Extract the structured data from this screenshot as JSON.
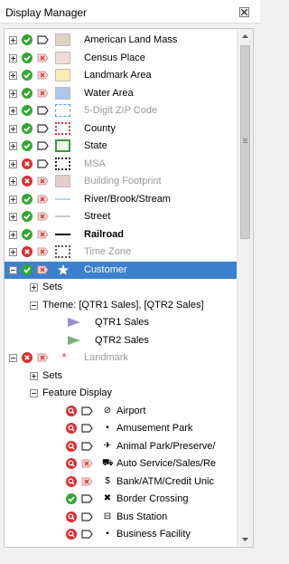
{
  "window": {
    "title": "Display Manager"
  },
  "layers": [
    {
      "label": "American Land Mass",
      "status": "on",
      "tagged": false,
      "symbol": "fill-tan",
      "gray": false,
      "bold": false
    },
    {
      "label": "Census Place",
      "status": "on",
      "tagged": true,
      "symbol": "fill-pink",
      "gray": false,
      "bold": false
    },
    {
      "label": "Landmark Area",
      "status": "on",
      "tagged": true,
      "symbol": "fill-yellow",
      "gray": false,
      "bold": false
    },
    {
      "label": "Water Area",
      "status": "on",
      "tagged": true,
      "symbol": "fill-blue",
      "gray": false,
      "bold": false
    },
    {
      "label": "5-Digit ZIP Code",
      "status": "on",
      "tagged": false,
      "symbol": "dashed-blue",
      "gray": true,
      "bold": false
    },
    {
      "label": "County",
      "status": "on",
      "tagged": false,
      "symbol": "dotted-red",
      "gray": false,
      "bold": false
    },
    {
      "label": "State",
      "status": "on",
      "tagged": false,
      "symbol": "solid-green",
      "gray": false,
      "bold": false
    },
    {
      "label": "MSA",
      "status": "off",
      "tagged": false,
      "symbol": "dotted-black",
      "gray": true,
      "bold": false
    },
    {
      "label": "Building Footprint",
      "status": "off",
      "tagged": true,
      "symbol": "fill-pink-gray",
      "gray": true,
      "bold": false
    },
    {
      "label": "River/Brook/Stream",
      "status": "on",
      "tagged": true,
      "symbol": "line-blue",
      "gray": false,
      "bold": false
    },
    {
      "label": "Street",
      "status": "on",
      "tagged": true,
      "symbol": "line-gray",
      "gray": false,
      "bold": false
    },
    {
      "label": "Railroad",
      "status": "on",
      "tagged": true,
      "symbol": "line-black",
      "gray": false,
      "bold": true
    },
    {
      "label": "Time Zone",
      "status": "off",
      "tagged": true,
      "symbol": "dotted-dark",
      "gray": true,
      "bold": false
    }
  ],
  "customer": {
    "label": "Customer",
    "sets_label": "Sets",
    "theme_label": "Theme: [QTR1 Sales], [QTR2 Sales]",
    "theme_items": [
      {
        "label": "QTR1 Sales",
        "color": "#9b8fd0"
      },
      {
        "label": "QTR2 Sales",
        "color": "#7ab07a"
      }
    ]
  },
  "landmark": {
    "label": "Landmark",
    "sets_label": "Sets",
    "feature_label": "Feature Display",
    "features": [
      {
        "label": "Airport",
        "status": "zoom",
        "tagged": false,
        "icon": "airport-icon",
        "glyph": "⊘"
      },
      {
        "label": "Amusement Park",
        "status": "zoom",
        "tagged": false,
        "icon": "amusement-icon",
        "glyph": "▪"
      },
      {
        "label": "Animal Park/Preserve/",
        "status": "zoom",
        "tagged": false,
        "icon": "animal-icon",
        "glyph": "✈"
      },
      {
        "label": "Auto Service/Sales/Re",
        "status": "zoom",
        "tagged": true,
        "icon": "car-icon",
        "glyph": "⛟"
      },
      {
        "label": "Bank/ATM/Credit Unic",
        "status": "zoom",
        "tagged": true,
        "icon": "bank-icon",
        "glyph": "$"
      },
      {
        "label": "Border Crossing",
        "status": "on",
        "tagged": false,
        "icon": "border-icon",
        "glyph": "✖"
      },
      {
        "label": "Bus Station",
        "status": "zoom",
        "tagged": false,
        "icon": "bus-icon",
        "glyph": "⊟"
      },
      {
        "label": "Business Facility",
        "status": "zoom",
        "tagged": false,
        "icon": "business-icon",
        "glyph": "▪"
      }
    ]
  },
  "colors": {
    "on": "#2fa82f",
    "off": "#d83030",
    "zoom": "#d83030",
    "selected": "#3c80ce"
  }
}
